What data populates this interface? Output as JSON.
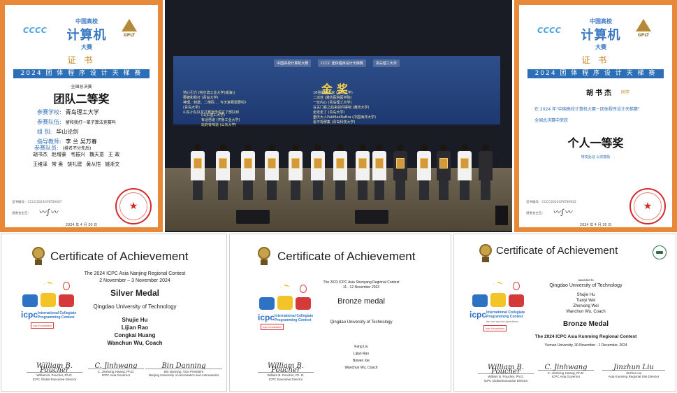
{
  "cert_cn_team": {
    "brand_left": "CCCC",
    "brand_top": "中国高校",
    "brand_main": "计算机",
    "brand_bottom": "大赛",
    "brand_right": "GPLT",
    "title": "证 书",
    "banner": "2024 团 体 程 序 设 计 天 梯 赛",
    "subtitle": "全国总决赛",
    "award": "团队二等奖",
    "fields": [
      {
        "key": "参赛学校:",
        "value": "青岛理工大学"
      },
      {
        "key": "参赛队伍:",
        "value": "留和我打一辈子算法竞赛吗"
      },
      {
        "key": "组    别:",
        "value": "华山论剑"
      },
      {
        "key": "指导教师:",
        "value": "李  兰   吴万春"
      },
      {
        "key": "参赛队员:",
        "value": "(排名不分先后)"
      }
    ],
    "members": [
      "胡书杰",
      "赵增豪",
      "韦振兴",
      "魏天意",
      "王  政",
      "王维泽",
      "常  奥",
      "饶礼建",
      "黄从恺",
      "姚淅文"
    ],
    "cert_id": "证书编号：CCCC2024GPLT00007",
    "signature_label": "组委会主任：",
    "date": "2024 年 4 月 30 日"
  },
  "photo": {
    "chip_1": "中国高校计算机大赛",
    "chip_2": "CCCC 团体程序设计天梯赛",
    "chip_3": "青岛理工大学",
    "heading": "金奖",
    "col_left": [
      "地心引力 (哈尔滨工业大学(威海))",
      "要被和我打 (青岛大学)",
      "神理、刺激、二维码 ... 今天复赛需要吗?",
      "(青岛大学)",
      "山东小队队友打赛宣传语言了部队到"
    ],
    "col_mid": [
      "(山东理工大学)",
      "有话悟道 (齐鲁工业大学)",
      "玩的有味道 (山东大学)"
    ],
    "col_right": [
      "16强制格斗家 (青岛大学)",
      "二凉佳 (潍坊医院医学院)",
      "一玩内心 (青岛理工大学)",
      "在关门看之后来如问得吧 (潍坊大学)",
      "走走走了 (青岛大学)",
      "重庆大人PabMadRaBra (中国海洋大学)",
      "看不得那集 (青岛科技大学)"
    ]
  },
  "cert_cn_individual": {
    "brand_left": "CCCC",
    "brand_top": "中国高校",
    "brand_main": "计算机",
    "brand_bottom": "大赛",
    "brand_right": "GPLT",
    "title": "证 书",
    "banner": "2024 团 体 程 序 设 计 天 梯 赛",
    "name": "胡书杰",
    "name_suffix": "同学",
    "line1": "在 2024 年\"中国高校计算机大赛－团体程序设计天梯赛\"",
    "line2": "全国总决赛中荣获",
    "award": "个人一等奖",
    "tag": "特发此证  以资鼓励",
    "cert_id": "证书编号：CCCC2024GPLT00923",
    "signature_label": "组委会主任：",
    "date": "2024 年 4 月 30 日"
  },
  "icpc_nanjing": {
    "title": "Certificate of Achievement",
    "contest": "The 2024 ICPC Asia Nanjing Regional Contest",
    "dates": "2 November – 3 November 2024",
    "medal": "Silver Medal",
    "university": "Qingdao University of Technology",
    "team": [
      "Shujie Hu",
      "Lijian Rao",
      "Congkai Huang",
      "Wanchun Wu, Coach"
    ],
    "icpc_word": "icpc",
    "icpc_desc": [
      "International Collegiate",
      "Programming Contest"
    ],
    "foundation": "icpc foundation",
    "signatures": [
      {
        "scribble": "William B. Poucher",
        "name": "William B. Poucher, Ph.D.",
        "role": "ICPC Global Executive Director"
      },
      {
        "scribble": "C. Jinhwang",
        "name": "C. Jinshong Hwang, Ph.D.",
        "role": "ICPC Asia Governor"
      },
      {
        "scribble": "Bin Danning",
        "name": "Bin Danning, Vice President",
        "role": "Nanjing University of Aeronautics and Astronautics"
      }
    ]
  },
  "icpc_shenyang": {
    "title": "Certificate of Achievement",
    "contest": "The 2023 ICPC Asia Shenyang Regional Contest",
    "dates": "11 - 12 November 2023",
    "medal": "Bronze medal",
    "university": "Qingdao University of Technology",
    "team": [
      "Fang Liu",
      "Lijian Rao",
      "Bowen Xie",
      "Wanchun Wu, Coach"
    ],
    "icpc_word": "icpc",
    "icpc_desc": [
      "International Collegiate",
      "Programming Contest"
    ],
    "foundation": "icpc foundation",
    "signatures": [
      {
        "scribble": "William B. Poucher",
        "name": "William B. Poucher, Ph. D.",
        "role": "ICPC Executive Director"
      }
    ]
  },
  "icpc_kunming": {
    "title": "Certificate of Achievement",
    "awarded_to": "awarded to",
    "university": "Qingdao University of Technology",
    "team": [
      "Shujie Hu",
      "Tianyi Wei",
      "Zhenxing Wei",
      "Wanchun Wu, Coach"
    ],
    "medal": "Bronze Medal",
    "contest": "The 2024 ICPC Asia Kunming Regional Contest",
    "location_dates": "Yunnan University, 30 November - 1 December, 2024",
    "icpc_word": "icpc",
    "icpc_desc": [
      "International Collegiate",
      "Programming Contest"
    ],
    "icpc_tagline": "the nerd sport for generations",
    "foundation": "icpc foundation",
    "signatures": [
      {
        "scribble": "William B. Poucher",
        "name": "William B. Poucher, Ph.D.",
        "role": "ICPC Global Executive Director"
      },
      {
        "scribble": "C. Jinhwang",
        "name": "C. Jinshong Hwang, Ph.D.",
        "role": "ICPC Asia Governor"
      },
      {
        "scribble": "Jinzhun Liu",
        "name": "Jinzhun Liu",
        "role": "Asia Kunming Regional Site Director"
      }
    ]
  }
}
